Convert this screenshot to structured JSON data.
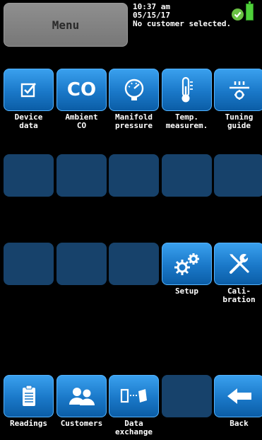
{
  "header": {
    "menu_label": "Menu",
    "time": "10:37 am",
    "date": "05/15/17",
    "customer_status": "No customer selected."
  },
  "row1": {
    "device_data": "Device\ndata",
    "ambient_co": "Ambient\nCO",
    "ambient_co_icon_text": "CO",
    "manifold_pressure": "Manifold\npressure",
    "temp_measurement": "Temp.\nmeasurem.",
    "tuning_guide": "Tuning\nguide"
  },
  "row3": {
    "setup": "Setup",
    "calibration": "Cali-\nbration"
  },
  "bottom": {
    "readings": "Readings",
    "customers": "Customers",
    "data_exchange": "Data\nexchange",
    "back": "Back"
  },
  "icons": {
    "device_data": "checkbox-icon",
    "manifold_pressure": "gauge-icon",
    "temp_measurement": "thermometer-icon",
    "tuning_guide": "flame-tuning-icon",
    "setup": "gears-icon",
    "calibration": "wrench-screwdriver-icon",
    "readings": "clipboard-icon",
    "customers": "people-icon",
    "data_exchange": "transfer-icon",
    "back": "back-arrow-icon",
    "status": "check-icon",
    "battery": "battery-icon"
  },
  "colors": {
    "tile_active": "#1a78c8",
    "tile_inactive": "#17426b",
    "menu_button": "#808080",
    "status_ok": "#6ac043",
    "battery": "#4fd03a"
  }
}
